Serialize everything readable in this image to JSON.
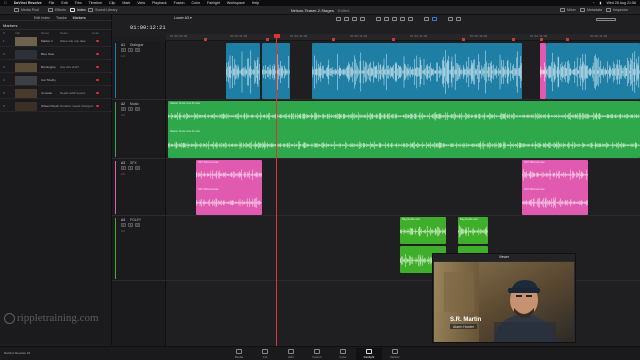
{
  "menubar": {
    "app": "DaVinci Resolve",
    "items": [
      "File",
      "Edit",
      "Trim",
      "Timeline",
      "Clip",
      "Mark",
      "View",
      "Playback",
      "Fusion",
      "Color",
      "Fairlight",
      "Workspace",
      "Help"
    ],
    "clock": "Wed 28 Aug 21:56"
  },
  "toolbar": {
    "left": [
      "Media Pool",
      "Effects",
      "Index",
      "Sound Library"
    ],
    "active_left": "Index",
    "project_title": "Nelson-Teaser-2-Stages",
    "project_status": "Edited",
    "right": [
      "Mixer",
      "Metadata",
      "Inspector"
    ]
  },
  "index_panel": {
    "tabs": [
      "Edit Index",
      "Tracks",
      "Markers"
    ],
    "active_tab": "Markers",
    "heading": "Markers",
    "columns": [
      "#",
      "Clip",
      "Name",
      "Notes",
      "Color"
    ],
    "markers": [
      {
        "num": "1",
        "name": "Marker 1",
        "note": "Wave into one take",
        "thumb": "#6f6350"
      },
      {
        "num": "2",
        "name": "Blue Note",
        "note": "",
        "thumb": "#2d3138"
      },
      {
        "num": "3",
        "name": "Bot Engine",
        "note": "Use this shot?",
        "thumb": "#5a4a38"
      },
      {
        "num": "4",
        "name": "Car Shelby",
        "note": "",
        "thumb": "#3c3f44"
      },
      {
        "num": "5",
        "name": "Console",
        "note": "Needs add'l sound",
        "thumb": "#4a3a2e"
      },
      {
        "num": "6",
        "name": "Wheel Check",
        "note": "Duration needs changed",
        "thumb": "#3a3026"
      }
    ]
  },
  "timecode": {
    "main": "01:00:12:21"
  },
  "timeline": {
    "tab_name": "Lower A3",
    "ruler_labels": [
      "01:00:00:00",
      "01:00:06:00",
      "01:00:12:00",
      "01:00:18:00",
      "01:00:24:00",
      "01:00:30:00",
      "01:00:36:00",
      "01:00:42:00"
    ],
    "tracks": [
      {
        "id": "A1",
        "name": "Dialogue",
        "channels": "1.0",
        "color": "#1f7ea3"
      },
      {
        "id": "A2",
        "name": "Music",
        "channels": "2.0",
        "color": "#2ea84a"
      },
      {
        "id": "A3",
        "name": "SFX",
        "channels": "2.0",
        "color": "#e05ab0"
      },
      {
        "id": "A4",
        "name": "FOLEY",
        "channels": "2.0",
        "color": "#3fae2b"
      }
    ],
    "music_clip_label": "Nelson Score Cue 01.wav",
    "sfx_clip_label": "SFX Whoosh.wav",
    "foley_clip_label": "Bag Rustle.wav"
  },
  "viewer": {
    "title": "Viewer",
    "lower_third_name": "S.R. Martin",
    "lower_third_role": "Alarm Hunter"
  },
  "pages": [
    "Media",
    "Cut",
    "Edit",
    "Fusion",
    "Color",
    "Fairlight",
    "Deliver"
  ],
  "active_page": "Fairlight",
  "footer": {
    "version": "DaVinci Resolve 19",
    "watermark": "rippletraining.com"
  }
}
